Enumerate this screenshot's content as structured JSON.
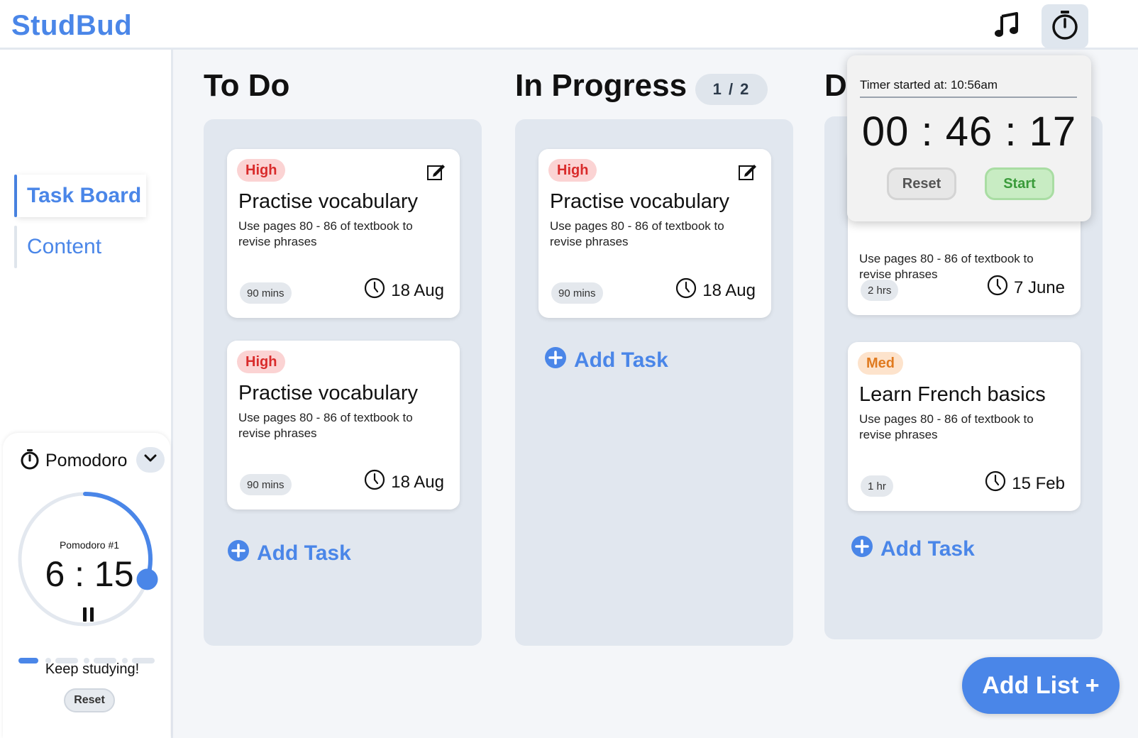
{
  "header": {
    "brand": "StudBud",
    "music_icon": "music-note-icon",
    "timer_icon": "stopwatch-icon"
  },
  "sidebar": {
    "items": [
      {
        "label": "Task Board",
        "active": true
      },
      {
        "label": "Content",
        "active": false
      }
    ]
  },
  "pomodoro": {
    "title": "Pomodoro",
    "session_label": "Pomodoro #1",
    "time": "6 : 15",
    "progress": 0.3,
    "message": "Keep studying!",
    "reset_label": "Reset"
  },
  "lists": [
    {
      "title": "To Do",
      "cards": [
        {
          "priority": "High",
          "title": "Practise vocabulary",
          "desc": "Use pages 80 - 86 of textbook to revise phrases",
          "duration": "90 mins",
          "due": "18 Aug"
        },
        {
          "priority": "High",
          "title": "Practise vocabulary",
          "desc": "Use pages 80 - 86 of textbook to revise phrases",
          "duration": "90 mins",
          "due": "18 Aug"
        }
      ],
      "add_label": "Add Task"
    },
    {
      "title": "In Progress",
      "count": "1 / 2",
      "cards": [
        {
          "priority": "High",
          "title": "Practise vocabulary",
          "desc": "Use pages 80 - 86 of textbook to revise phrases",
          "duration": "90 mins",
          "due": "18 Aug"
        }
      ],
      "add_label": "Add Task"
    },
    {
      "title": "D",
      "cards": [
        {
          "desc": "Use pages 80 - 86 of textbook to revise phrases",
          "duration": "2 hrs",
          "due": "7 June"
        },
        {
          "priority": "Med",
          "title": "Learn French basics",
          "desc": "Use pages 80 - 86 of textbook to revise phrases",
          "duration": "1 hr",
          "due": "15 Feb"
        }
      ],
      "add_label": "Add Task"
    }
  ],
  "timer_popover": {
    "label": "Timer started at: 10:56am",
    "time": "00 : 46 : 17",
    "reset_label": "Reset",
    "start_label": "Start"
  },
  "add_list_label": "Add List +",
  "colors": {
    "accent": "#4a86e8",
    "high": "#d92b2b",
    "med": "#e07a1f",
    "start": "#3a9b3a"
  }
}
